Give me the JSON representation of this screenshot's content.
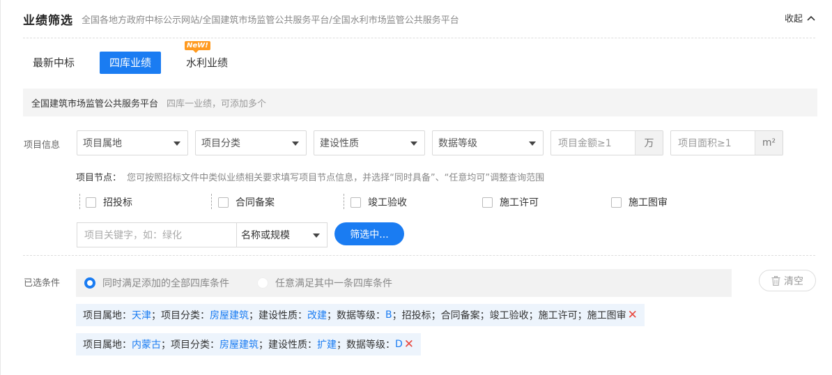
{
  "header": {
    "title": "业绩筛选",
    "subtitle": "全国各地方政府中标公示网站/全国建筑市场监管公共服务平台/全国水利市场监管公共服务平台",
    "collapse_label": "收起"
  },
  "tabs": [
    {
      "label": "最新中标",
      "active": false
    },
    {
      "label": "四库业绩",
      "active": true
    },
    {
      "label": "水利业绩",
      "active": false,
      "badge": "NeW!"
    }
  ],
  "platform": {
    "name": "全国建筑市场监管公共服务平台",
    "hint": "四库一业绩，可添加多个"
  },
  "project_info": {
    "label": "项目信息",
    "selects": [
      "项目属地",
      "项目分类",
      "建设性质",
      "数据等级"
    ],
    "amount": {
      "placeholder": "项目金额≥1",
      "unit": "万"
    },
    "area": {
      "placeholder": "项目面积≥1",
      "unit": "m²"
    }
  },
  "nodes": {
    "label": "项目节点：",
    "hint": "您可按照招标文件中类似业绩相关要求填写项目节点信息，并选择“同时具备”、“任意均可”调整查询范围",
    "items": [
      "招投标",
      "合同备案",
      "竣工验收",
      "施工许可",
      "施工图审"
    ]
  },
  "keyword": {
    "placeholder": "项目关键字，如：绿化",
    "mode": "名称或规模",
    "filter_button": "筛选中..."
  },
  "selected": {
    "label": "已选条件",
    "radio_all": "同时满足添加的全部四库条件",
    "radio_any": "任意满足其中一条四库条件",
    "clear_button": "清空",
    "tags": [
      {
        "p1": "项目属地：",
        "v1": "天津",
        "p2": "；项目分类：",
        "v2": "房屋建筑",
        "p3": "；建设性质：",
        "v3": "改建",
        "p4": "；数据等级：",
        "v4": "B",
        "p5": "；招投标；合同备案；竣工验收；施工许可；施工图审"
      },
      {
        "p1": "项目属地：",
        "v1": "内蒙古",
        "p2": "；项目分类：",
        "v2": "房屋建筑",
        "p3": "；建设性质：",
        "v3": "扩建",
        "p4": "；数据等级：",
        "v4": "D",
        "p5": ""
      }
    ]
  },
  "colors": {
    "accent": "#1a7cf2",
    "remove": "#e8473e",
    "badge": "#ff9a1f"
  }
}
